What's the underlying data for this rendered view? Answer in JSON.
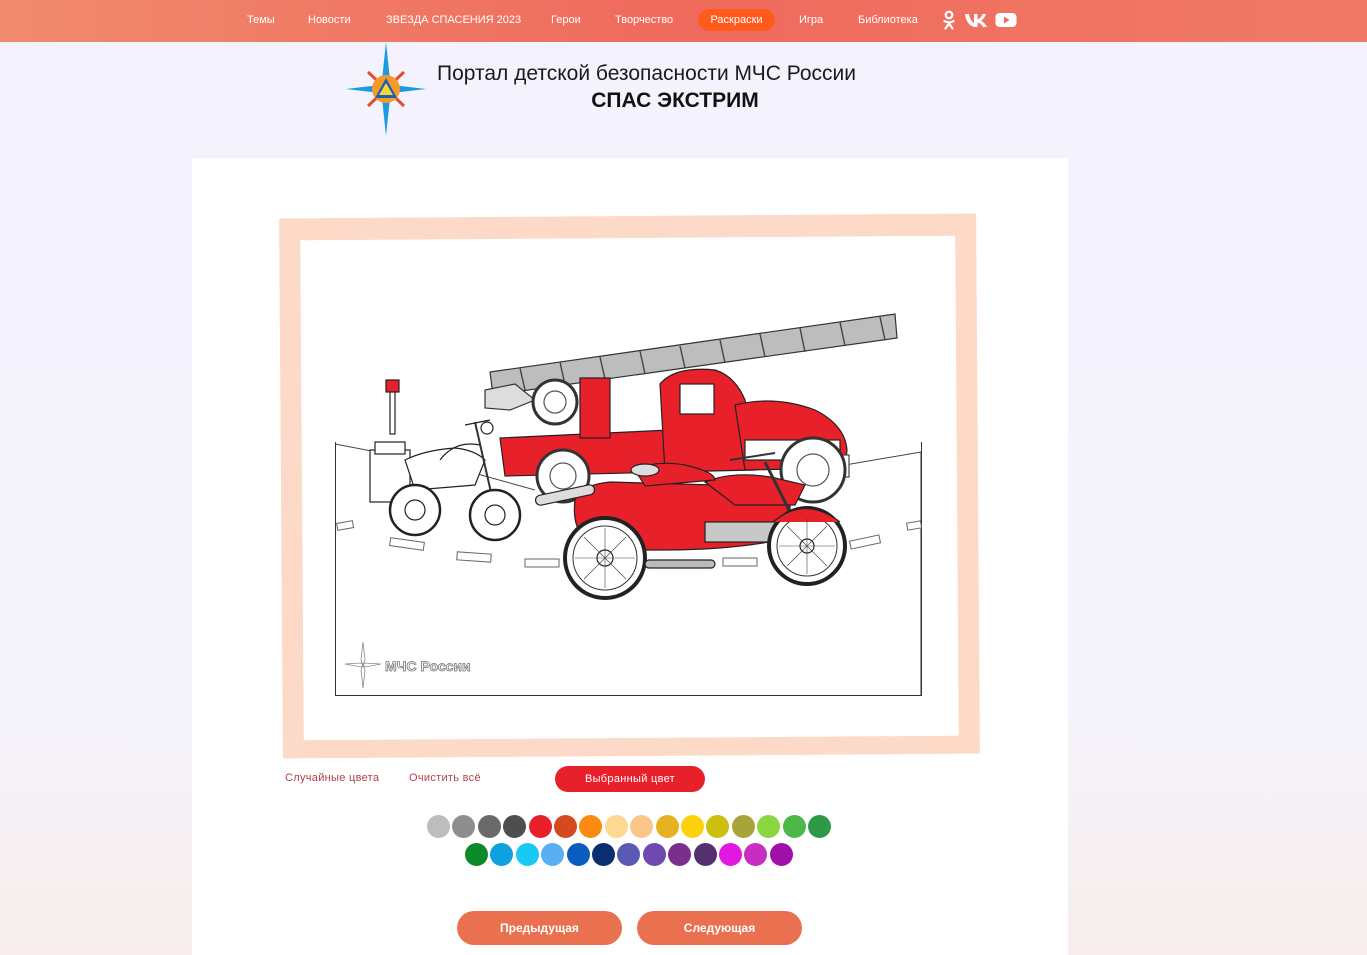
{
  "nav": {
    "items": [
      {
        "label": "Темы"
      },
      {
        "label": "Новости"
      },
      {
        "label": "ЗВЕЗДА СПАСЕНИЯ 2023"
      },
      {
        "label": "Герои"
      },
      {
        "label": "Творчество"
      },
      {
        "label": "Раскраски",
        "active": true
      },
      {
        "label": "Игра"
      },
      {
        "label": "Библиотека"
      }
    ],
    "social": [
      "odnoklassniki-icon",
      "vk-icon",
      "youtube-icon"
    ]
  },
  "header": {
    "title": "Портал детской безопасности МЧС России",
    "subtitle": "СПАС ЭКСТРИМ"
  },
  "coloring": {
    "watermark": "МЧС России",
    "random_colors_label": "Случайные цвета",
    "clear_all_label": "Очистить всё",
    "selected_color_label": "Выбранный цвет",
    "selected_color": "#e8202a"
  },
  "palette": {
    "row1": [
      "#bdbdbd",
      "#8e8e8e",
      "#6a6a6a",
      "#4e4e4e",
      "#e8202a",
      "#d44a1e",
      "#fb8a10",
      "#fcd890",
      "#fbc788",
      "#e7b222",
      "#fbd20c",
      "#cdbf0e",
      "#a8a43a",
      "#8ad63e",
      "#4cb84a",
      "#2e9a48"
    ],
    "row2": [
      "#0c8a2a",
      "#0ea1dd",
      "#1ac8f4",
      "#5aaef2",
      "#0a5cbe",
      "#0a2f6e",
      "#5a5ab6",
      "#6e4ab0",
      "#7a2e8e",
      "#55306e",
      "#e018e0",
      "#c82cc0",
      "#a010a8"
    ]
  },
  "pagination": {
    "prev_label": "Предыдущая",
    "next_label": "Следующая"
  },
  "colors": {
    "nav_bg": "#ef6a5c",
    "nav_active": "#ff5a1e",
    "button": "#ea7150",
    "frame": "#fdd9c8",
    "link": "#b0424a"
  }
}
